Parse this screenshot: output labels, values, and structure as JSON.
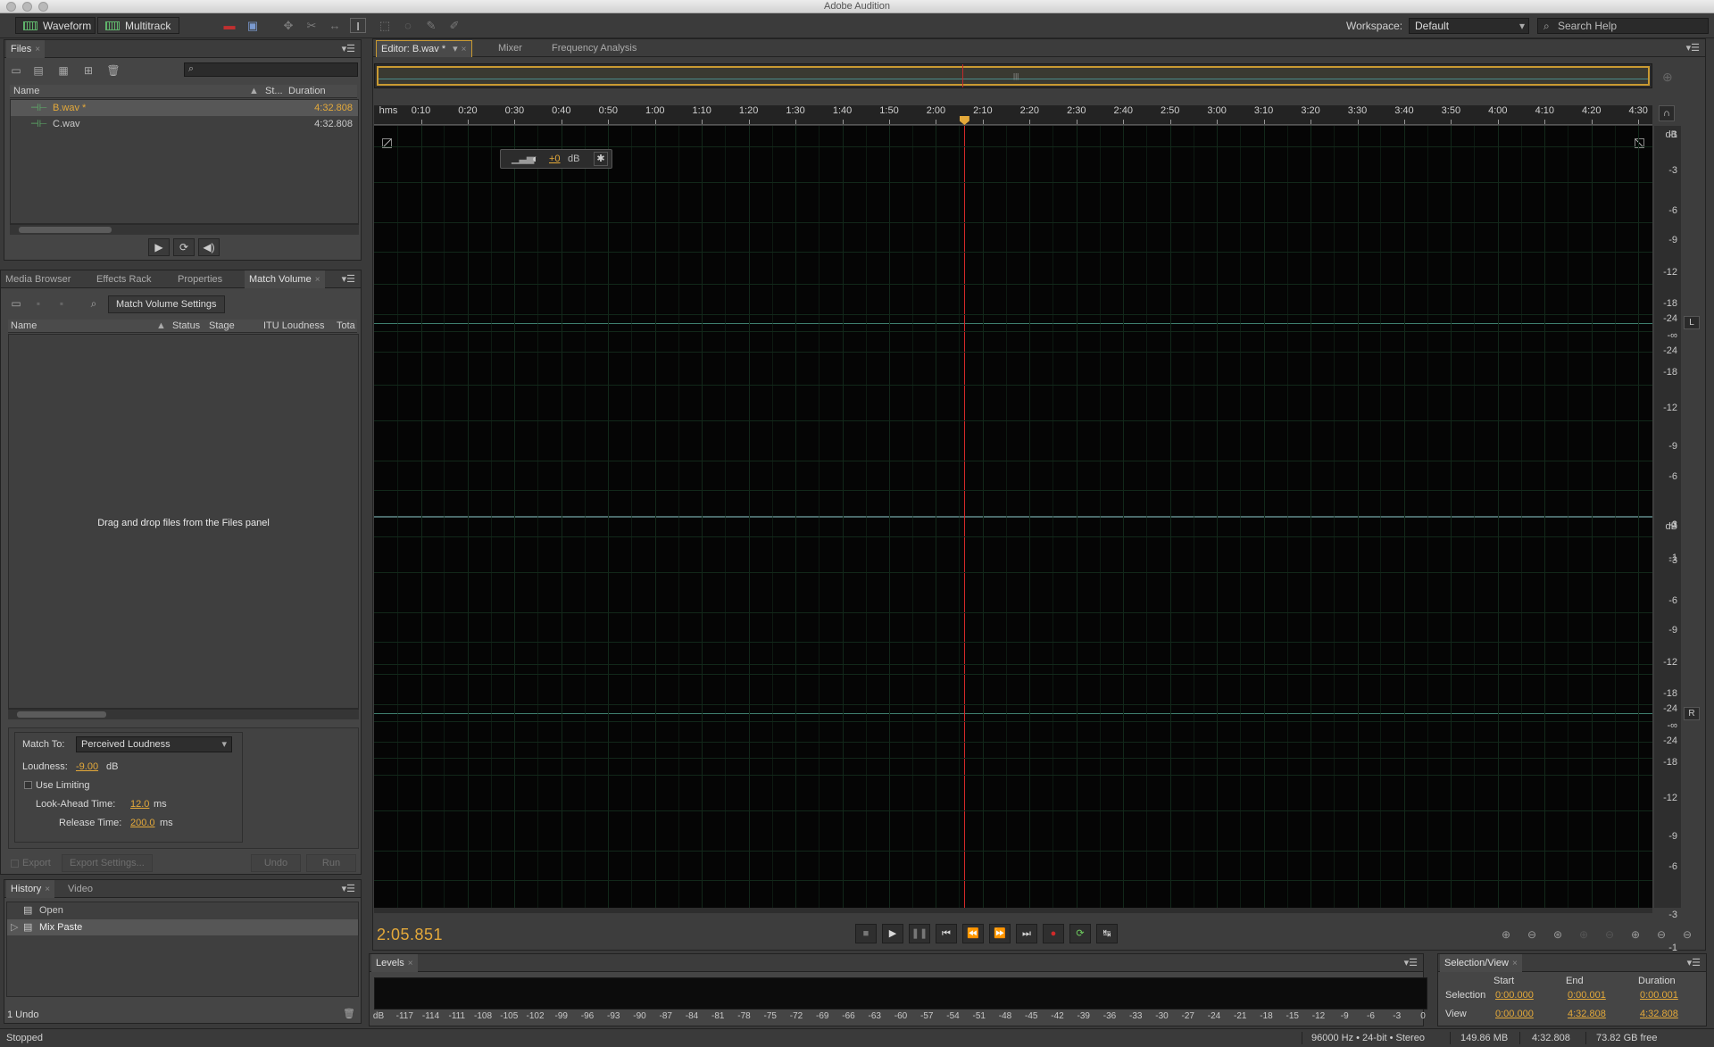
{
  "window_title": "Adobe Audition",
  "toolbar": {
    "waveform_label": "Waveform",
    "multitrack_label": "Multitrack",
    "workspace_label": "Workspace:",
    "workspace_value": "Default",
    "search_placeholder": "Search Help"
  },
  "files_panel": {
    "tab": "Files",
    "columns": {
      "name": "Name",
      "status": "St...",
      "duration": "Duration"
    },
    "files": [
      {
        "name": "B.wav *",
        "duration": "4:32.808"
      },
      {
        "name": "C.wav",
        "duration": "4:32.808"
      }
    ]
  },
  "tool_panel": {
    "tabs": [
      "Media Browser",
      "Effects Rack",
      "Properties",
      "Match Volume"
    ],
    "settings_button": "Match Volume Settings",
    "columns": [
      "Name",
      "Status",
      "Stage",
      "ITU Loudness",
      "Tota"
    ],
    "empty_message": "Drag and drop files from the Files panel",
    "match_to_label": "Match To:",
    "match_to_value": "Perceived Loudness",
    "loudness_label": "Loudness:",
    "loudness_value": "-9.00",
    "loudness_unit": "dB",
    "use_limiting_label": "Use Limiting",
    "lookahead_label": "Look-Ahead Time:",
    "lookahead_value": "12.0",
    "lookahead_unit": "ms",
    "release_label": "Release Time:",
    "release_value": "200.0",
    "release_unit": "ms",
    "export_label": "Export",
    "export_settings_label": "Export Settings...",
    "undo_label": "Undo",
    "run_label": "Run"
  },
  "history_panel": {
    "tabs": [
      "History",
      "Video"
    ],
    "items": [
      "Open",
      "Mix Paste"
    ],
    "undo_count": "1 Undo"
  },
  "editor": {
    "tabs": [
      "Editor: B.wav *",
      "Mixer",
      "Frequency Analysis"
    ],
    "ruler_unit": "hms",
    "ruler_ticks": [
      "0:10",
      "0:20",
      "0:30",
      "0:40",
      "0:50",
      "1:00",
      "1:10",
      "1:20",
      "1:30",
      "1:40",
      "1:50",
      "2:00",
      "2:10",
      "2:20",
      "2:30",
      "2:40",
      "2:50",
      "3:00",
      "3:10",
      "3:20",
      "3:30",
      "3:40",
      "3:50",
      "4:00",
      "4:10",
      "4:20",
      "4:30"
    ],
    "hud_gain": "+0",
    "hud_unit": "dB",
    "db_unit": "dB",
    "db_scale_left": [
      "-1",
      "-3",
      "-6",
      "-9",
      "-12",
      "-18",
      "-24",
      "-∞",
      "-24",
      "-18",
      "-12",
      "-9",
      "-6",
      "-3",
      "-1"
    ],
    "db_scale_right": [
      "-1",
      "-3",
      "-6",
      "-9",
      "-12",
      "-18",
      "-24",
      "-∞",
      "-24",
      "-18",
      "-12",
      "-9",
      "-6",
      "-3",
      "-1"
    ],
    "channel_left": "L",
    "channel_right": "R",
    "current_time": "2:05.851",
    "playhead_fraction": 0.4615
  },
  "levels_panel": {
    "tab": "Levels",
    "scale": [
      "dB",
      "-117",
      "-114",
      "-111",
      "-108",
      "-105",
      "-102",
      "-99",
      "-96",
      "-93",
      "-90",
      "-87",
      "-84",
      "-81",
      "-78",
      "-75",
      "-72",
      "-69",
      "-66",
      "-63",
      "-60",
      "-57",
      "-54",
      "-51",
      "-48",
      "-45",
      "-42",
      "-39",
      "-36",
      "-33",
      "-30",
      "-27",
      "-24",
      "-21",
      "-18",
      "-15",
      "-12",
      "-9",
      "-6",
      "-3",
      "0"
    ]
  },
  "selection_view": {
    "tab": "Selection/View",
    "headers": [
      "Start",
      "End",
      "Duration"
    ],
    "selection_label": "Selection",
    "selection": [
      "0:00.000",
      "0:00.001",
      "0:00.001"
    ],
    "view_label": "View",
    "view": [
      "0:00.000",
      "4:32.808",
      "4:32.808"
    ]
  },
  "status": {
    "state": "Stopped",
    "format": "96000 Hz • 24-bit • Stereo",
    "size": "149.86 MB",
    "duration": "4:32.808",
    "free": "73.82 GB free"
  },
  "colors": {
    "accent": "#e4a93a",
    "playhead": "#d42a2a",
    "waveform_bg": "#050505",
    "file_icon": "#5fb36b"
  }
}
